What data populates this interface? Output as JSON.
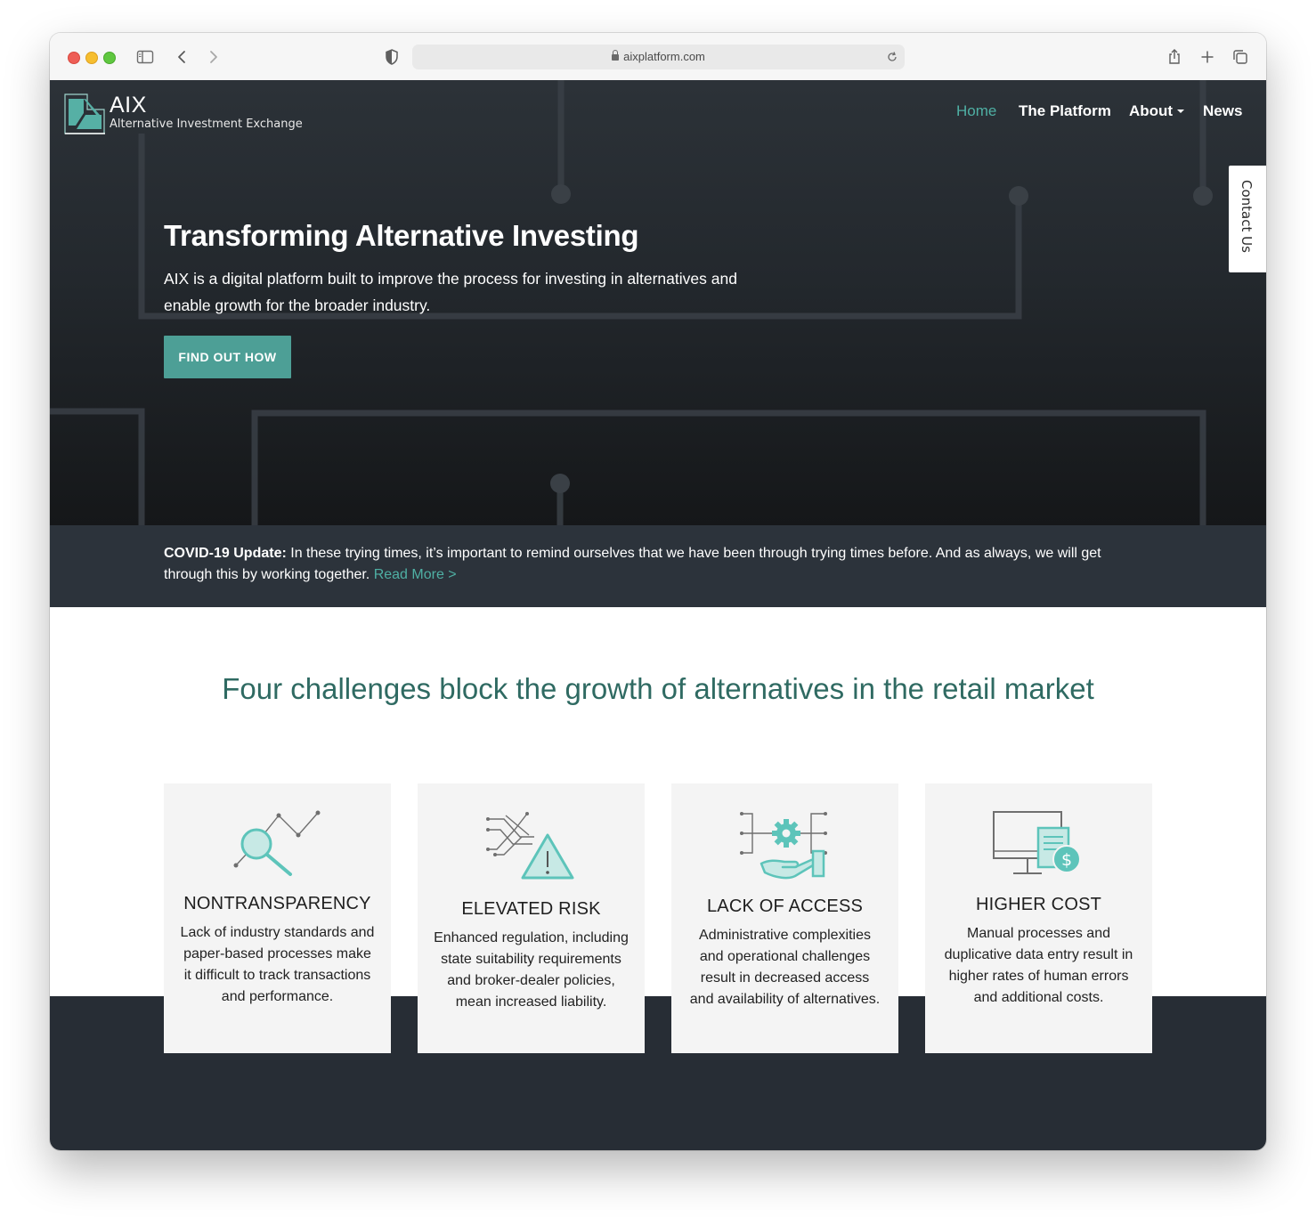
{
  "browser": {
    "url": "aixplatform.com"
  },
  "header": {
    "logo_title": "AIX",
    "logo_subtitle": "Alternative Investment Exchange",
    "nav": {
      "home": "Home",
      "platform": "The Platform",
      "about": "About",
      "news": "News"
    },
    "contact_tab": "Contact Us"
  },
  "hero": {
    "title": "Transforming Alternative Investing",
    "description": "AIX is a digital platform built to improve the process for investing in alternatives and enable growth for the broader industry.",
    "cta": "FIND OUT HOW"
  },
  "covid": {
    "label": "COVID-19 Update:",
    "text": " In these trying times, it’s important to remind ourselves that we have been through trying times before. And as always, we will get through this by working together. ",
    "link": "Read More >"
  },
  "challenges": {
    "heading": "Four challenges block the growth of alternatives in the retail market",
    "cards": [
      {
        "title": "NONTRANSPARENCY",
        "icon": "magnifier-chart-icon",
        "text": "Lack of industry standards and paper-based processes make it difficult to track transactions and performance."
      },
      {
        "title": "ELEVATED RISK",
        "icon": "warning-network-icon",
        "text": "Enhanced regulation, including state suitability requirements and broker-dealer policies, mean increased liability."
      },
      {
        "title": "LACK OF ACCESS",
        "icon": "gear-hand-icon",
        "text": "Administrative complexities and operational challenges result in decreased access and availability of alternatives."
      },
      {
        "title": "HIGHER COST",
        "icon": "monitor-dollar-icon",
        "text": "Manual processes and duplicative data entry result in higher rates of human errors and additional costs."
      }
    ]
  },
  "colors": {
    "accent": "#4d9f96",
    "heading_teal": "#2f6a62",
    "dark": "#2c333b",
    "card_bg": "#f4f4f4"
  }
}
